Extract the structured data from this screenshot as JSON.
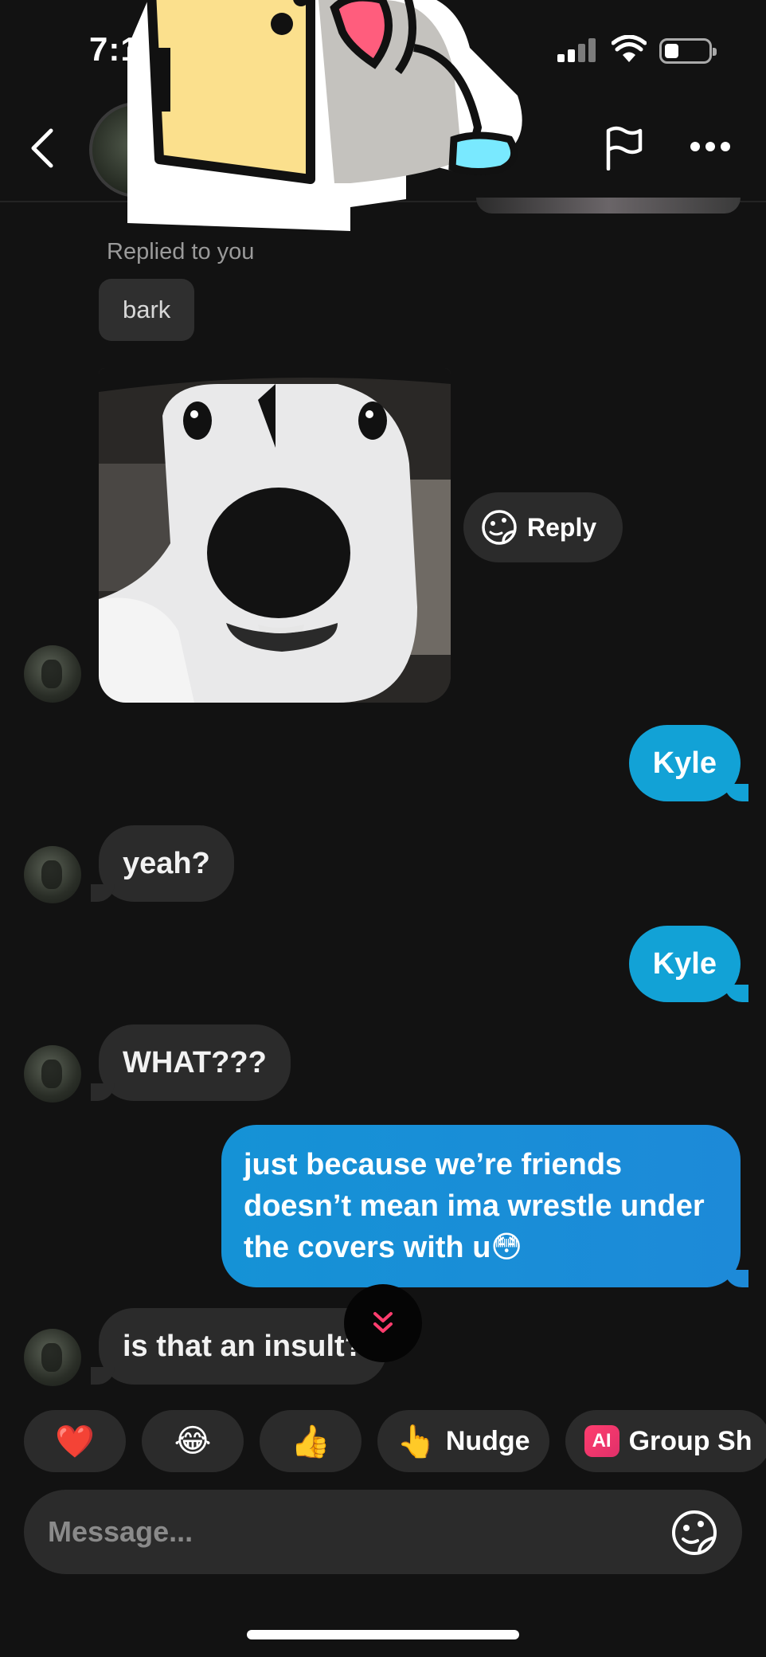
{
  "status_bar": {
    "time": "7:1",
    "battery_level": 0.25
  },
  "header": {
    "back_icon": "chevron-left-icon",
    "flag_icon": "flag-icon",
    "more_icon": "more-horizontal-icon"
  },
  "thread": {
    "reply_context": "Replied to you",
    "quoted_text": "bark",
    "gif_reply_label": "Reply",
    "messages": [
      {
        "direction": "out",
        "text": "Kyle"
      },
      {
        "direction": "in",
        "text": "yeah?"
      },
      {
        "direction": "out",
        "text": "Kyle"
      },
      {
        "direction": "in",
        "text": "WHAT???"
      },
      {
        "direction": "out",
        "text": "just because we’re friends doesn’t mean ima wrestle under the covers with u😳"
      },
      {
        "direction": "in",
        "text": "is that an insult?"
      }
    ]
  },
  "quick_reactions": [
    {
      "label": "❤️"
    },
    {
      "label": "😂"
    },
    {
      "label": "👍"
    },
    {
      "label": "Nudge",
      "emoji": "👆"
    },
    {
      "label": "Group Sh",
      "badge": "AI"
    }
  ],
  "composer": {
    "placeholder": "Message..."
  },
  "colors": {
    "background": "#121212",
    "incoming_bubble": "#2b2b2b",
    "outgoing_bubble": "#12a2d6",
    "accent_red": "#ff3d6e"
  }
}
